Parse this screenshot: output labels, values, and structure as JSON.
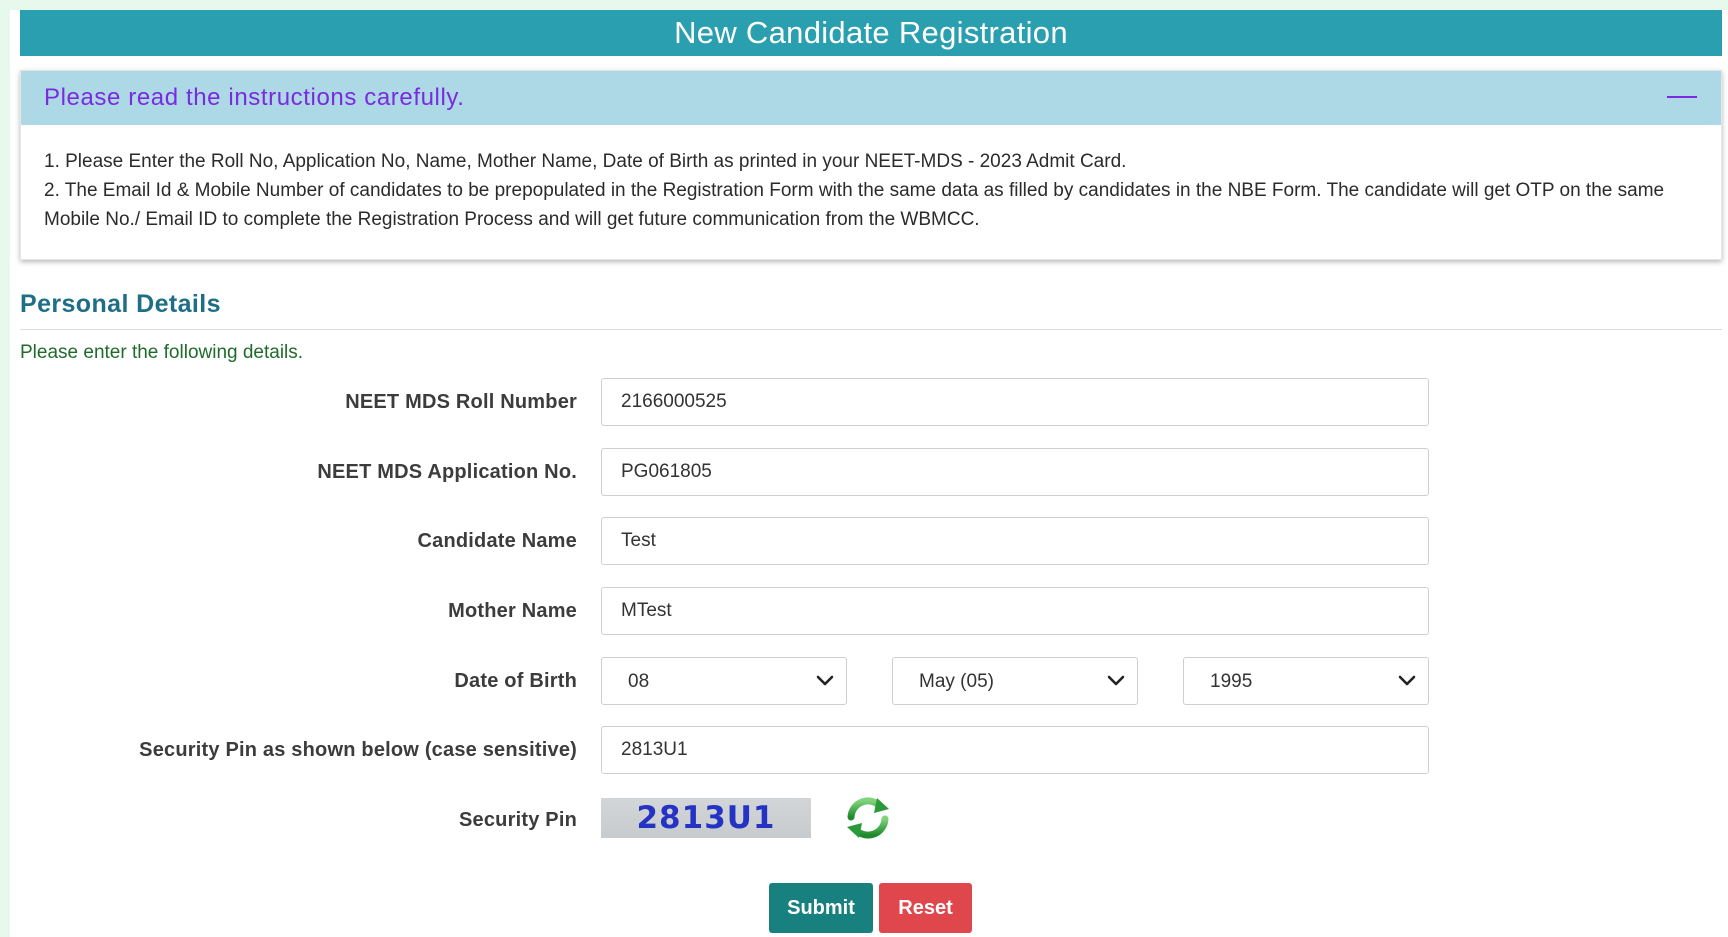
{
  "header": {
    "title": "New Candidate Registration"
  },
  "instructions": {
    "heading": "Please read the instructions carefully.",
    "lines": [
      "1. Please Enter the Roll No, Application No, Name, Mother Name, Date of Birth as printed in your NEET-MDS - 2023 Admit Card.",
      "2. The Email Id & Mobile Number of candidates to be prepopulated in the Registration Form with the same data as filled by candidates in the NBE Form. The candidate will get OTP on the same Mobile No./ Email ID to complete the Registration Process and will get future communication from the WBMCC."
    ]
  },
  "personal": {
    "title": "Personal Details",
    "subtitle": "Please enter the following details."
  },
  "form": {
    "roll": {
      "label": "NEET MDS Roll Number",
      "value": "2166000525"
    },
    "app": {
      "label": "NEET MDS Application No.",
      "value": "PG061805"
    },
    "name": {
      "label": "Candidate Name",
      "value": "Test"
    },
    "mother": {
      "label": "Mother Name",
      "value": "MTest"
    },
    "dob": {
      "label": "Date of Birth",
      "day": "08",
      "month": "May (05)",
      "year": "1995"
    },
    "pin_input": {
      "label": "Security Pin as shown below (case sensitive)",
      "value": "2813U1"
    },
    "captcha": {
      "label": "Security Pin",
      "text": "2813U1"
    }
  },
  "buttons": {
    "submit": "Submit",
    "reset": "Reset"
  },
  "colors": {
    "title_bar": "#2a9faf",
    "panel_head": "#add8e6",
    "heading_text": "#7a2be0",
    "section_title": "#1e6e86",
    "submit": "#18807f",
    "reset": "#e0474c",
    "refresh_icon": "#2a9a3a"
  },
  "icons": {
    "collapse": "minus-icon",
    "dropdown": "chevron-down-icon",
    "refresh": "refresh-icon"
  }
}
